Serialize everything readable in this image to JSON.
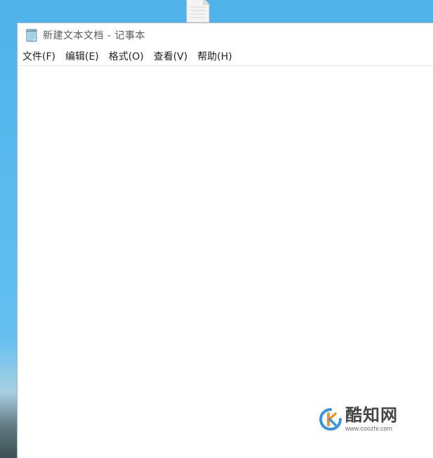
{
  "window": {
    "title": "新建文本文档 - 记事本",
    "app_icon": "notepad-icon"
  },
  "menu": {
    "items": [
      {
        "label": "文件(F)"
      },
      {
        "label": "编辑(E)"
      },
      {
        "label": "格式(O)"
      },
      {
        "label": "查看(V)"
      },
      {
        "label": "帮助(H)"
      }
    ]
  },
  "editor": {
    "content": ""
  },
  "desktop": {
    "file_icon": "text-file-icon"
  },
  "watermark": {
    "brand": "酷知网",
    "url": "www.coozhi.com",
    "logo_icon": "coozhi-logo-icon"
  },
  "colors": {
    "desktop_blue": "#5bbcf0",
    "window_bg": "#ffffff",
    "title_text": "#5a5a5a",
    "logo_orange": "#f28c28",
    "logo_blue": "#2f8fdd"
  }
}
